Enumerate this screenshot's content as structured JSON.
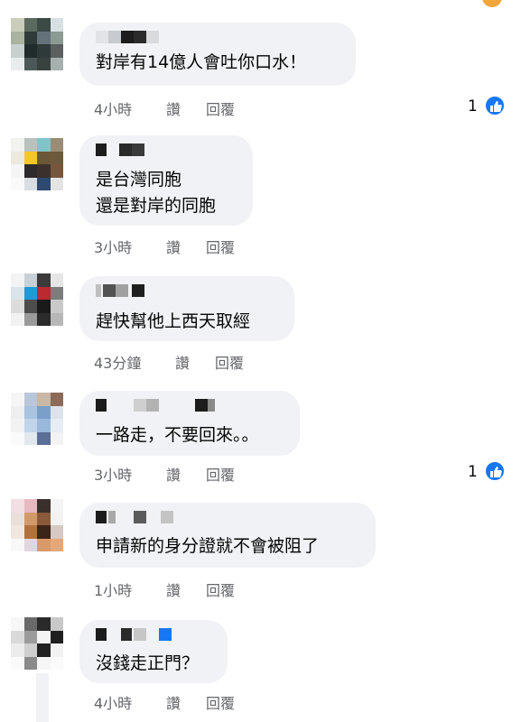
{
  "colors": {
    "bubble": "#f0f2f5",
    "meta": "#65676b",
    "like_blue": "#1877f2"
  },
  "actions": {
    "like": "讚",
    "reply": "回覆"
  },
  "comments": [
    {
      "text": "對岸有14億人會吐你口水！",
      "time": "4小時",
      "reactions": "1",
      "reaction_icon": "like-icon"
    },
    {
      "text": "是台灣同胞\n還是對岸的同胞",
      "time": "3小時"
    },
    {
      "text": "趕快幫他上西天取經",
      "time": "43分鐘"
    },
    {
      "text": "一路走，不要回來。。",
      "time": "3小時",
      "reactions": "1",
      "reaction_icon": "like-icon"
    },
    {
      "text": "申請新的身分證就不會被阻了",
      "time": "1小時"
    },
    {
      "text": "沒錢走正門？",
      "time": "4小時"
    }
  ]
}
